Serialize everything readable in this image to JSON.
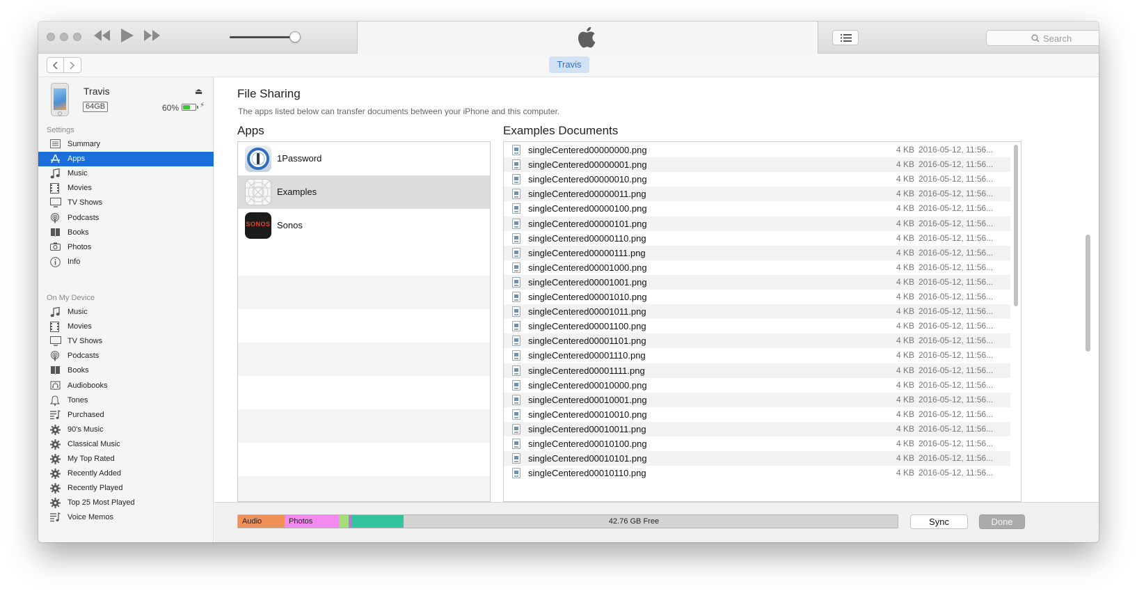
{
  "window": {
    "device_tab": "Travis",
    "search_placeholder": "Search"
  },
  "device": {
    "name": "Travis",
    "capacity": "64GB",
    "battery_percent_label": "60%",
    "battery_level": 0.6
  },
  "sidebar": {
    "settings_title": "Settings",
    "settings_items": [
      {
        "label": "Summary",
        "icon": "summary-icon"
      },
      {
        "label": "Apps",
        "icon": "apps-icon",
        "selected": true
      },
      {
        "label": "Music",
        "icon": "music-icon"
      },
      {
        "label": "Movies",
        "icon": "movies-icon"
      },
      {
        "label": "TV Shows",
        "icon": "tv-icon"
      },
      {
        "label": "Podcasts",
        "icon": "podcasts-icon"
      },
      {
        "label": "Books",
        "icon": "books-icon"
      },
      {
        "label": "Photos",
        "icon": "camera-icon"
      },
      {
        "label": "Info",
        "icon": "info-icon"
      }
    ],
    "device_title": "On My Device",
    "device_items": [
      {
        "label": "Music",
        "icon": "music-icon"
      },
      {
        "label": "Movies",
        "icon": "movies-icon"
      },
      {
        "label": "TV Shows",
        "icon": "tv-icon"
      },
      {
        "label": "Podcasts",
        "icon": "podcasts-icon"
      },
      {
        "label": "Books",
        "icon": "books-icon"
      },
      {
        "label": "Audiobooks",
        "icon": "audiobooks-icon"
      },
      {
        "label": "Tones",
        "icon": "bell-icon"
      },
      {
        "label": "Purchased",
        "icon": "playlist-icon"
      },
      {
        "label": "90's Music",
        "icon": "smart-playlist-gear-icon"
      },
      {
        "label": "Classical Music",
        "icon": "smart-playlist-gear-icon"
      },
      {
        "label": "My Top Rated",
        "icon": "smart-playlist-gear-icon"
      },
      {
        "label": "Recently Added",
        "icon": "smart-playlist-gear-icon"
      },
      {
        "label": "Recently Played",
        "icon": "smart-playlist-gear-icon"
      },
      {
        "label": "Top 25 Most Played",
        "icon": "smart-playlist-gear-icon"
      },
      {
        "label": "Voice Memos",
        "icon": "playlist-icon"
      }
    ]
  },
  "main": {
    "title": "File Sharing",
    "description": "The apps listed below can transfer documents between your iPhone and this computer.",
    "apps_title": "Apps",
    "apps": [
      {
        "name": "1Password",
        "icon": "1password-icon"
      },
      {
        "name": "Examples",
        "icon": "examples-icon",
        "selected": true
      },
      {
        "name": "Sonos",
        "icon": "sonos-icon",
        "icon_text": "SONOS"
      }
    ],
    "documents_title": "Examples Documents",
    "documents": [
      {
        "name": "singleCentered00000000.png",
        "size": "4 KB",
        "date": "2016-05-12, 11:56..."
      },
      {
        "name": "singleCentered00000001.png",
        "size": "4 KB",
        "date": "2016-05-12, 11:56..."
      },
      {
        "name": "singleCentered00000010.png",
        "size": "4 KB",
        "date": "2016-05-12, 11:56..."
      },
      {
        "name": "singleCentered00000011.png",
        "size": "4 KB",
        "date": "2016-05-12, 11:56..."
      },
      {
        "name": "singleCentered00000100.png",
        "size": "4 KB",
        "date": "2016-05-12, 11:56..."
      },
      {
        "name": "singleCentered00000101.png",
        "size": "4 KB",
        "date": "2016-05-12, 11:56..."
      },
      {
        "name": "singleCentered00000110.png",
        "size": "4 KB",
        "date": "2016-05-12, 11:56..."
      },
      {
        "name": "singleCentered00000111.png",
        "size": "4 KB",
        "date": "2016-05-12, 11:56..."
      },
      {
        "name": "singleCentered00001000.png",
        "size": "4 KB",
        "date": "2016-05-12, 11:56..."
      },
      {
        "name": "singleCentered00001001.png",
        "size": "4 KB",
        "date": "2016-05-12, 11:56..."
      },
      {
        "name": "singleCentered00001010.png",
        "size": "4 KB",
        "date": "2016-05-12, 11:56..."
      },
      {
        "name": "singleCentered00001011.png",
        "size": "4 KB",
        "date": "2016-05-12, 11:56..."
      },
      {
        "name": "singleCentered00001100.png",
        "size": "4 KB",
        "date": "2016-05-12, 11:56..."
      },
      {
        "name": "singleCentered00001101.png",
        "size": "4 KB",
        "date": "2016-05-12, 11:56..."
      },
      {
        "name": "singleCentered00001110.png",
        "size": "4 KB",
        "date": "2016-05-12, 11:56..."
      },
      {
        "name": "singleCentered00001111.png",
        "size": "4 KB",
        "date": "2016-05-12, 11:56..."
      },
      {
        "name": "singleCentered00010000.png",
        "size": "4 KB",
        "date": "2016-05-12, 11:56..."
      },
      {
        "name": "singleCentered00010001.png",
        "size": "4 KB",
        "date": "2016-05-12, 11:56..."
      },
      {
        "name": "singleCentered00010010.png",
        "size": "4 KB",
        "date": "2016-05-12, 11:56..."
      },
      {
        "name": "singleCentered00010011.png",
        "size": "4 KB",
        "date": "2016-05-12, 11:56..."
      },
      {
        "name": "singleCentered00010100.png",
        "size": "4 KB",
        "date": "2016-05-12, 11:56..."
      },
      {
        "name": "singleCentered00010101.png",
        "size": "4 KB",
        "date": "2016-05-12, 11:56..."
      },
      {
        "name": "singleCentered00010110.png",
        "size": "4 KB",
        "date": "2016-05-12, 11:56..."
      }
    ]
  },
  "footer": {
    "storage": {
      "audio_label": "Audio",
      "photos_label": "Photos",
      "free_label": "42.76 GB Free",
      "colors": {
        "audio": "#f0915a",
        "photos": "#f38af0",
        "apps": "#a3de7b",
        "docs": "#b57ad8",
        "other": "#35c59e",
        "free": "#d4d4d4"
      }
    },
    "sync_label": "Sync",
    "done_label": "Done"
  },
  "colors": {
    "selection": "#1c6fdb",
    "device_tab_bg": "#d3e1f5",
    "device_tab_text": "#2a6cc8"
  }
}
